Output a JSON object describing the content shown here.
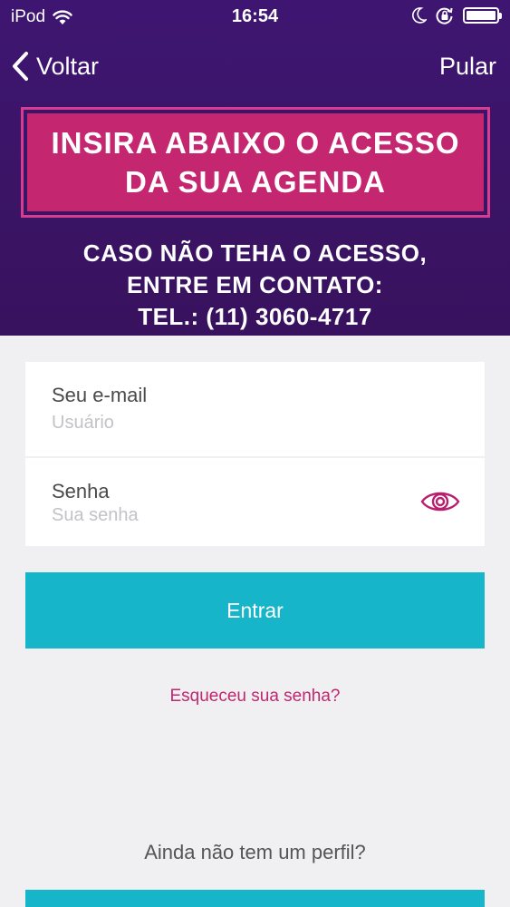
{
  "status_bar": {
    "device": "iPod",
    "time": "16:54",
    "icons": [
      "wifi-icon",
      "moon-icon",
      "rotation-lock-icon",
      "battery-icon"
    ]
  },
  "nav": {
    "back_label": "Voltar",
    "skip_label": "Pular"
  },
  "banner": {
    "line1": "INSIRA ABAIXO O ACESSO",
    "line2": "DA SUA AGENDA",
    "contact_line1": "CASO NÃO TEHA O ACESSO,",
    "contact_line2": "ENTRE EM CONTATO:",
    "contact_line3": "TEL.: (11) 3060-4717"
  },
  "form": {
    "email_label": "Seu e-mail",
    "email_placeholder": "Usuário",
    "password_label": "Senha",
    "password_placeholder": "Sua senha",
    "login_label": "Entrar",
    "forgot_label": "Esqueceu sua senha?",
    "no_profile_label": "Ainda não tem um perfil?"
  },
  "colors": {
    "header_bg": "#3e1672",
    "banner_pink": "#c4266f",
    "accent_teal": "#16b5c9",
    "link_pink": "#c1276f"
  }
}
